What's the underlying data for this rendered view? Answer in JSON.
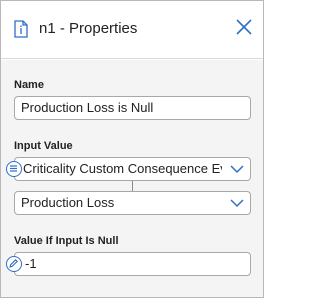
{
  "header": {
    "title": "n1 - Properties",
    "icon": "document-icon",
    "close_icon": "close-icon"
  },
  "name_section": {
    "label": "Name",
    "value": "Production Loss is Null"
  },
  "input_section": {
    "label": "Input Value",
    "source_value": "Criticality Custom Consequence Evalu",
    "source_icon": "list-icon",
    "field_value": "Production Loss"
  },
  "null_section": {
    "label": "Value If Input Is Null",
    "value": "-1",
    "icon": "edit-icon"
  },
  "colors": {
    "accent": "#2f6ec9",
    "panel_bg": "#f4f4f4"
  }
}
